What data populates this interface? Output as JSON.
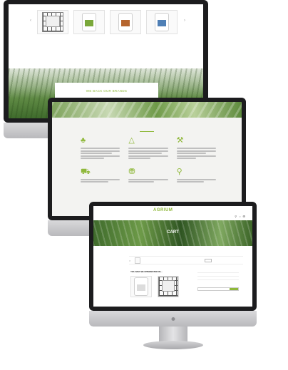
{
  "monitor1": {
    "products": [
      {
        "name": "",
        "meta": "",
        "link": "",
        "label_color": "#444444",
        "type": "tote"
      },
      {
        "name": "",
        "meta": "",
        "link": "",
        "label_color": "#7aa83a",
        "type": "jug"
      },
      {
        "name": "",
        "meta": "",
        "link": "",
        "label_color": "#b5642d",
        "type": "jug"
      },
      {
        "name": "",
        "meta": "",
        "link": "",
        "label_color": "#4f7fb5",
        "type": "jug"
      }
    ],
    "brand_banner": "WE BACK OUR BRANDS"
  },
  "monitor2": {
    "subtitle": "",
    "title": "",
    "features": [
      {
        "icon": "seedling-icon",
        "glyph": "♣",
        "title": ""
      },
      {
        "icon": "compass-icon",
        "glyph": "△",
        "title": ""
      },
      {
        "icon": "tools-icon",
        "glyph": "⚒",
        "title": ""
      },
      {
        "icon": "tractor-icon",
        "glyph": "⛟",
        "title": ""
      },
      {
        "icon": "cart-icon",
        "glyph": "⛃",
        "title": ""
      },
      {
        "icon": "map-pin-icon",
        "glyph": "⚲",
        "title": ""
      }
    ]
  },
  "monitor3": {
    "logo": "AGRIUM",
    "logo_sub": "",
    "nav_links": [
      "",
      "",
      "",
      "",
      "",
      ""
    ],
    "hero_title": "CART",
    "cart_headers": [
      "",
      "",
      "",
      "",
      ""
    ],
    "cart_item": {
      "name": "",
      "price": "",
      "subtotal": ""
    },
    "related_title": "YOU MAY BE INTERESTED IN...",
    "related_products": [
      {
        "name": ""
      },
      {
        "name": ""
      }
    ],
    "totals_title": "",
    "totals_rows": [
      {
        "label": "",
        "value": ""
      },
      {
        "label": "",
        "value": ""
      },
      {
        "label": "",
        "value": ""
      }
    ],
    "checkout_label": ""
  },
  "colors": {
    "accent": "#8fb83a",
    "bezel": "#1c1c1e"
  }
}
